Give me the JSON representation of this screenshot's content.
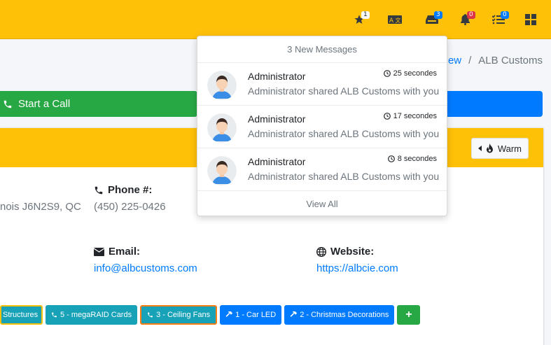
{
  "navbar": {
    "star_badge": "1",
    "inbox_badge": "3",
    "bell_badge": "0",
    "tasks_badge": "0",
    "colors": {
      "background": "#ffc107"
    }
  },
  "breadcrumb": {
    "link": "iew",
    "separator": "/",
    "current": "ALB Customs"
  },
  "actions": {
    "call_label": "Start a Call"
  },
  "card": {
    "warm_label": "Warm",
    "address_value": "nois J6N2S9, QC",
    "phone_label": "Phone #:",
    "phone_value": "(450) 225-0426",
    "email_label": "Email:",
    "email_value": "info@albcustoms.com",
    "website_label": "Website:",
    "website_value": "https://albcie.com"
  },
  "tags": [
    {
      "label": "Structures",
      "icon": ""
    },
    {
      "label": "5 - megaRAID Cards",
      "icon": "phone-volume-icon"
    },
    {
      "label": "3 - Ceiling Fans",
      "icon": "phone-volume-icon"
    },
    {
      "label": "1 - Car LED",
      "icon": "hammer-icon"
    },
    {
      "label": "2 - Christmas Decorations",
      "icon": "hammer-icon"
    },
    {
      "label": "+",
      "icon": ""
    }
  ],
  "messages_dropdown": {
    "header": "3 New Messages",
    "footer": "View All",
    "items": [
      {
        "name": "Administrator",
        "time": "25 secondes",
        "text": "Administrator shared ALB Customs with you"
      },
      {
        "name": "Administrator",
        "time": "17 secondes",
        "text": "Administrator shared ALB Customs with you"
      },
      {
        "name": "Administrator",
        "time": "8 secondes",
        "text": "Administrator shared ALB Customs with you"
      }
    ]
  }
}
